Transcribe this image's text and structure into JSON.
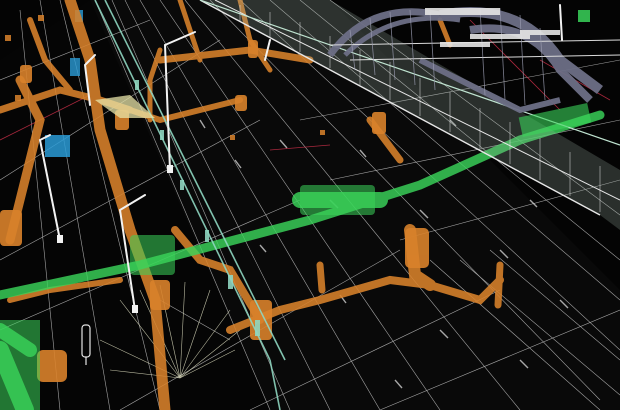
{
  "scene": {
    "description_visible_text": [],
    "colors": {
      "background": "#040404",
      "wireframe": "#d9d9d9",
      "bridge_rail": "#8fd6c0",
      "utility_orange": "#d9822b",
      "utility_green": "#3ad45a",
      "utility_blue": "#2a9bd6",
      "bridge_structure": "#6d6f86",
      "accent_red": "#d0304a",
      "light_pole": "#f2f2f2"
    }
  }
}
